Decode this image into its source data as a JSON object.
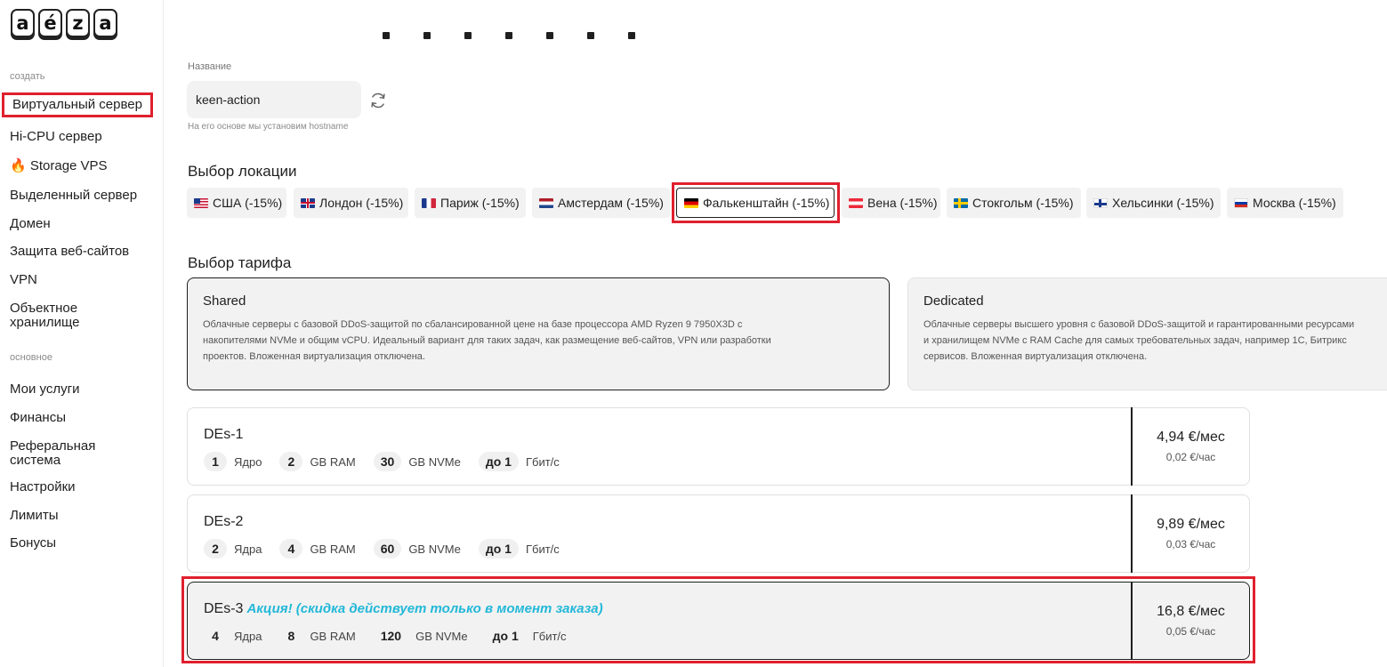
{
  "logo": {
    "letters": [
      "a",
      "é",
      "z",
      "a"
    ]
  },
  "sidebar": {
    "section_create": "создать",
    "create_items": [
      {
        "label": "Виртуальный сервер"
      },
      {
        "label": "Hi-CPU сервер"
      },
      {
        "label": "🔥 Storage VPS"
      },
      {
        "label": "Выделенный сервер"
      },
      {
        "label": "Домен"
      },
      {
        "label": "Защита веб-сайтов"
      },
      {
        "label": "VPN"
      },
      {
        "label": "Объектное хранилище"
      }
    ],
    "section_main": "основное",
    "main_items": [
      {
        "label": "Мои услуги"
      },
      {
        "label": "Финансы"
      },
      {
        "label": "Реферальная система"
      },
      {
        "label": "Настройки"
      },
      {
        "label": "Лимиты"
      },
      {
        "label": "Бонусы"
      }
    ]
  },
  "name_field": {
    "label": "Название",
    "value": "keen-action",
    "hint": "На его основе мы установим hostname"
  },
  "location": {
    "title": "Выбор локации",
    "options": [
      {
        "label": "США (-15%)",
        "flag": "us-flag"
      },
      {
        "label": "Лондон (-15%)",
        "flag": "gb-flag"
      },
      {
        "label": "Париж (-15%)",
        "flag": "fr-flag"
      },
      {
        "label": "Амстердам (-15%)",
        "flag": "nl-flag"
      },
      {
        "label": "Фалькенштайн (-15%)",
        "flag": "de-flag",
        "selected": true
      },
      {
        "label": "Вена (-15%)",
        "flag": "at-flag"
      },
      {
        "label": "Стокгольм (-15%)",
        "flag": "se-flag"
      },
      {
        "label": "Хельсинки (-15%)",
        "flag": "fi-flag"
      },
      {
        "label": "Москва (-15%)",
        "flag": "ru-flag"
      }
    ]
  },
  "tariff": {
    "title": "Выбор тарифа",
    "types": [
      {
        "title": "Shared",
        "lines": [
          "Облачные серверы с базовой DDoS-защитой по сбалансированной цене на базе процессора AMD Ryzen 9 7950X3D с",
          "накопителями NVMe и общим vCPU. Идеальный вариант для таких задач, как размещение веб-сайтов, VPN или разработки",
          "проектов. Вложенная виртуализация отключена."
        ]
      },
      {
        "title": "Dedicated",
        "lines": [
          "Облачные серверы высшего уровня с базовой DDoS-защитой и гарантированными ресурсами",
          "и хранилищем NVMe с RAM Cache для самых требовательных задач, например 1С, Битрикс",
          "сервисов. Вложенная виртуализация отключена."
        ]
      }
    ]
  },
  "plans": [
    {
      "name": "DEs-1",
      "promo": "",
      "cpu": "1",
      "cpu_unit": "Ядро",
      "ram": "2",
      "ram_unit": "GB RAM",
      "disk": "30",
      "disk_unit": "GB NVMe",
      "net": "до 1",
      "net_unit": "Гбит/с",
      "price": "4,94 €/мес",
      "hourly": "0,02 €/час"
    },
    {
      "name": "DEs-2",
      "promo": "",
      "cpu": "2",
      "cpu_unit": "Ядра",
      "ram": "4",
      "ram_unit": "GB RAM",
      "disk": "60",
      "disk_unit": "GB NVMe",
      "net": "до 1",
      "net_unit": "Гбит/с",
      "price": "9,89 €/мес",
      "hourly": "0,03 €/час"
    },
    {
      "name": "DEs-3",
      "promo": "Акция! (скидка действует только в момент заказа)",
      "cpu": "4",
      "cpu_unit": "Ядра",
      "ram": "8",
      "ram_unit": "GB RAM",
      "disk": "120",
      "disk_unit": "GB NVMe",
      "net": "до 1",
      "net_unit": "Гбит/с",
      "price": "16,8 €/мес",
      "hourly": "0,05 €/час"
    }
  ],
  "colors": {
    "highlight": "#e0202e",
    "promo": "#22b8d8",
    "chip_bg": "#f2f2f2"
  }
}
